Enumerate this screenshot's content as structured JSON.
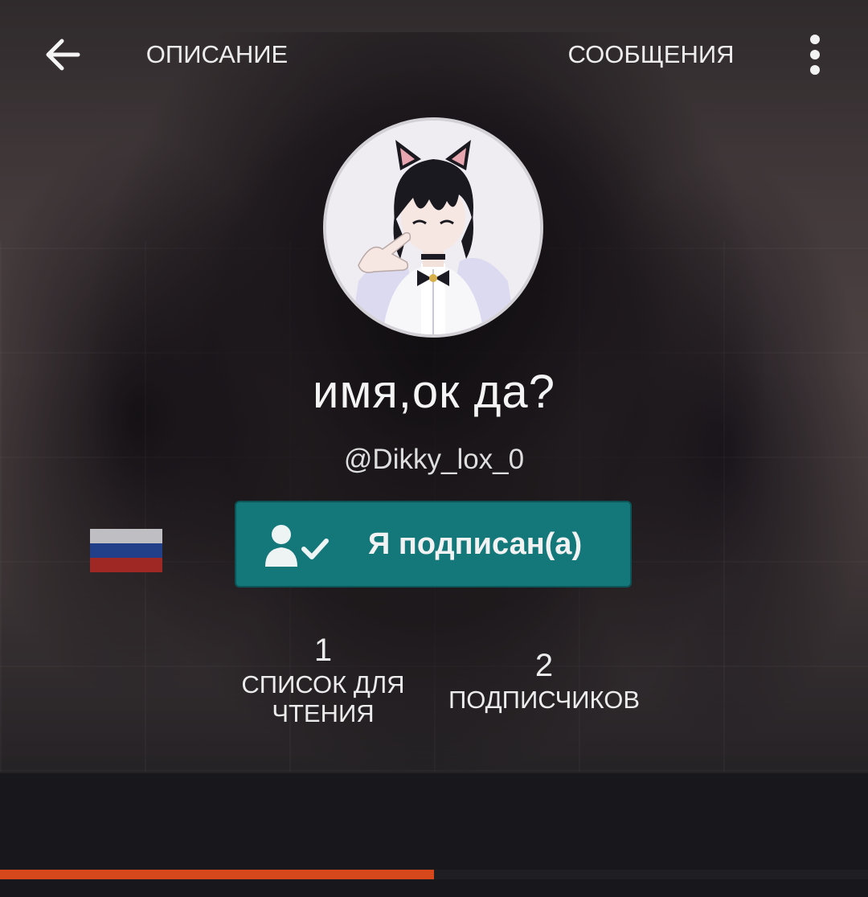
{
  "header": {
    "back_icon": "arrow-left-icon",
    "more_icon": "more-vertical-icon"
  },
  "profile": {
    "display_name": "имя,ок да?",
    "handle": "@Dikky_lox_0",
    "avatar": "anime-character-avatar"
  },
  "follow_button": {
    "label": "Я подписан(а)",
    "icon": "user-check-icon",
    "color": "#14777a"
  },
  "stats": [
    {
      "value": "1",
      "label_line1": "СПИСОК ДЛЯ",
      "label_line2": "ЧТЕНИЯ"
    },
    {
      "value": "2",
      "label_line1": "ПОДПИСЧИКОВ"
    }
  ],
  "tabs": [
    {
      "label": "ОПИСАНИЕ",
      "active": true
    },
    {
      "label": "СООБЩЕНИЯ",
      "active": false
    }
  ],
  "colors": {
    "accent": "#d6471c",
    "tab_bar": "#18171b"
  }
}
